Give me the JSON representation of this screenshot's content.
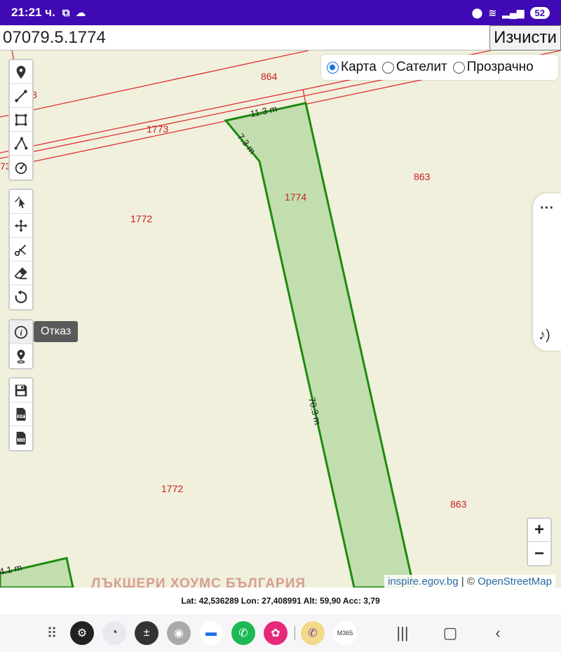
{
  "status": {
    "time": "21:21 ч.",
    "battery": "52"
  },
  "search": {
    "value": "07079.5.1774",
    "clear_label": "Изчисти"
  },
  "layers": {
    "options": [
      {
        "label": "Карта",
        "selected": true
      },
      {
        "label": "Сателит",
        "selected": false
      },
      {
        "label": "Прозрачно",
        "selected": false
      }
    ]
  },
  "map": {
    "parcel_labels": {
      "p864": "864",
      "p1773": "1773",
      "p1773_edge": "73",
      "p3_edge": "3",
      "p863_top": "863",
      "p1774": "1774",
      "p1772_top": "1772",
      "p1772_bottom": "1772",
      "p863_bottom": "863"
    },
    "measurements": {
      "top": "11.3 m",
      "left": "7.3 m",
      "long": "70.3 m",
      "corner": "4.1 m"
    },
    "parcel_color": "#c2deaf",
    "parcel_stroke": "#1e8a0e",
    "boundary_color": "#e03030"
  },
  "tools": {
    "group1": [
      "marker-icon",
      "polyline-icon",
      "rectangle-icon",
      "polygon-icon",
      "circle-icon"
    ],
    "group2": [
      "cursor-icon",
      "move-icon",
      "scissors-icon",
      "eraser-icon",
      "rotate-icon"
    ],
    "group3": [
      "info-icon",
      "location-pin-icon"
    ],
    "group4": [
      "save-icon",
      "shp-icon",
      "json-icon"
    ]
  },
  "tooltip": "Отказ",
  "zoom": {
    "in": "+",
    "out": "−"
  },
  "attribution": {
    "source": "inspire.egov.bg",
    "separator": " | © ",
    "osm": "OpenStreetMap"
  },
  "watermark": "ЛЪКШЕРИ ХОУМС БЪЛГАРИЯ",
  "coords": "Lat: 42,536289 Lon: 27,408991 Alt: 59,90 Acc: 3,79"
}
